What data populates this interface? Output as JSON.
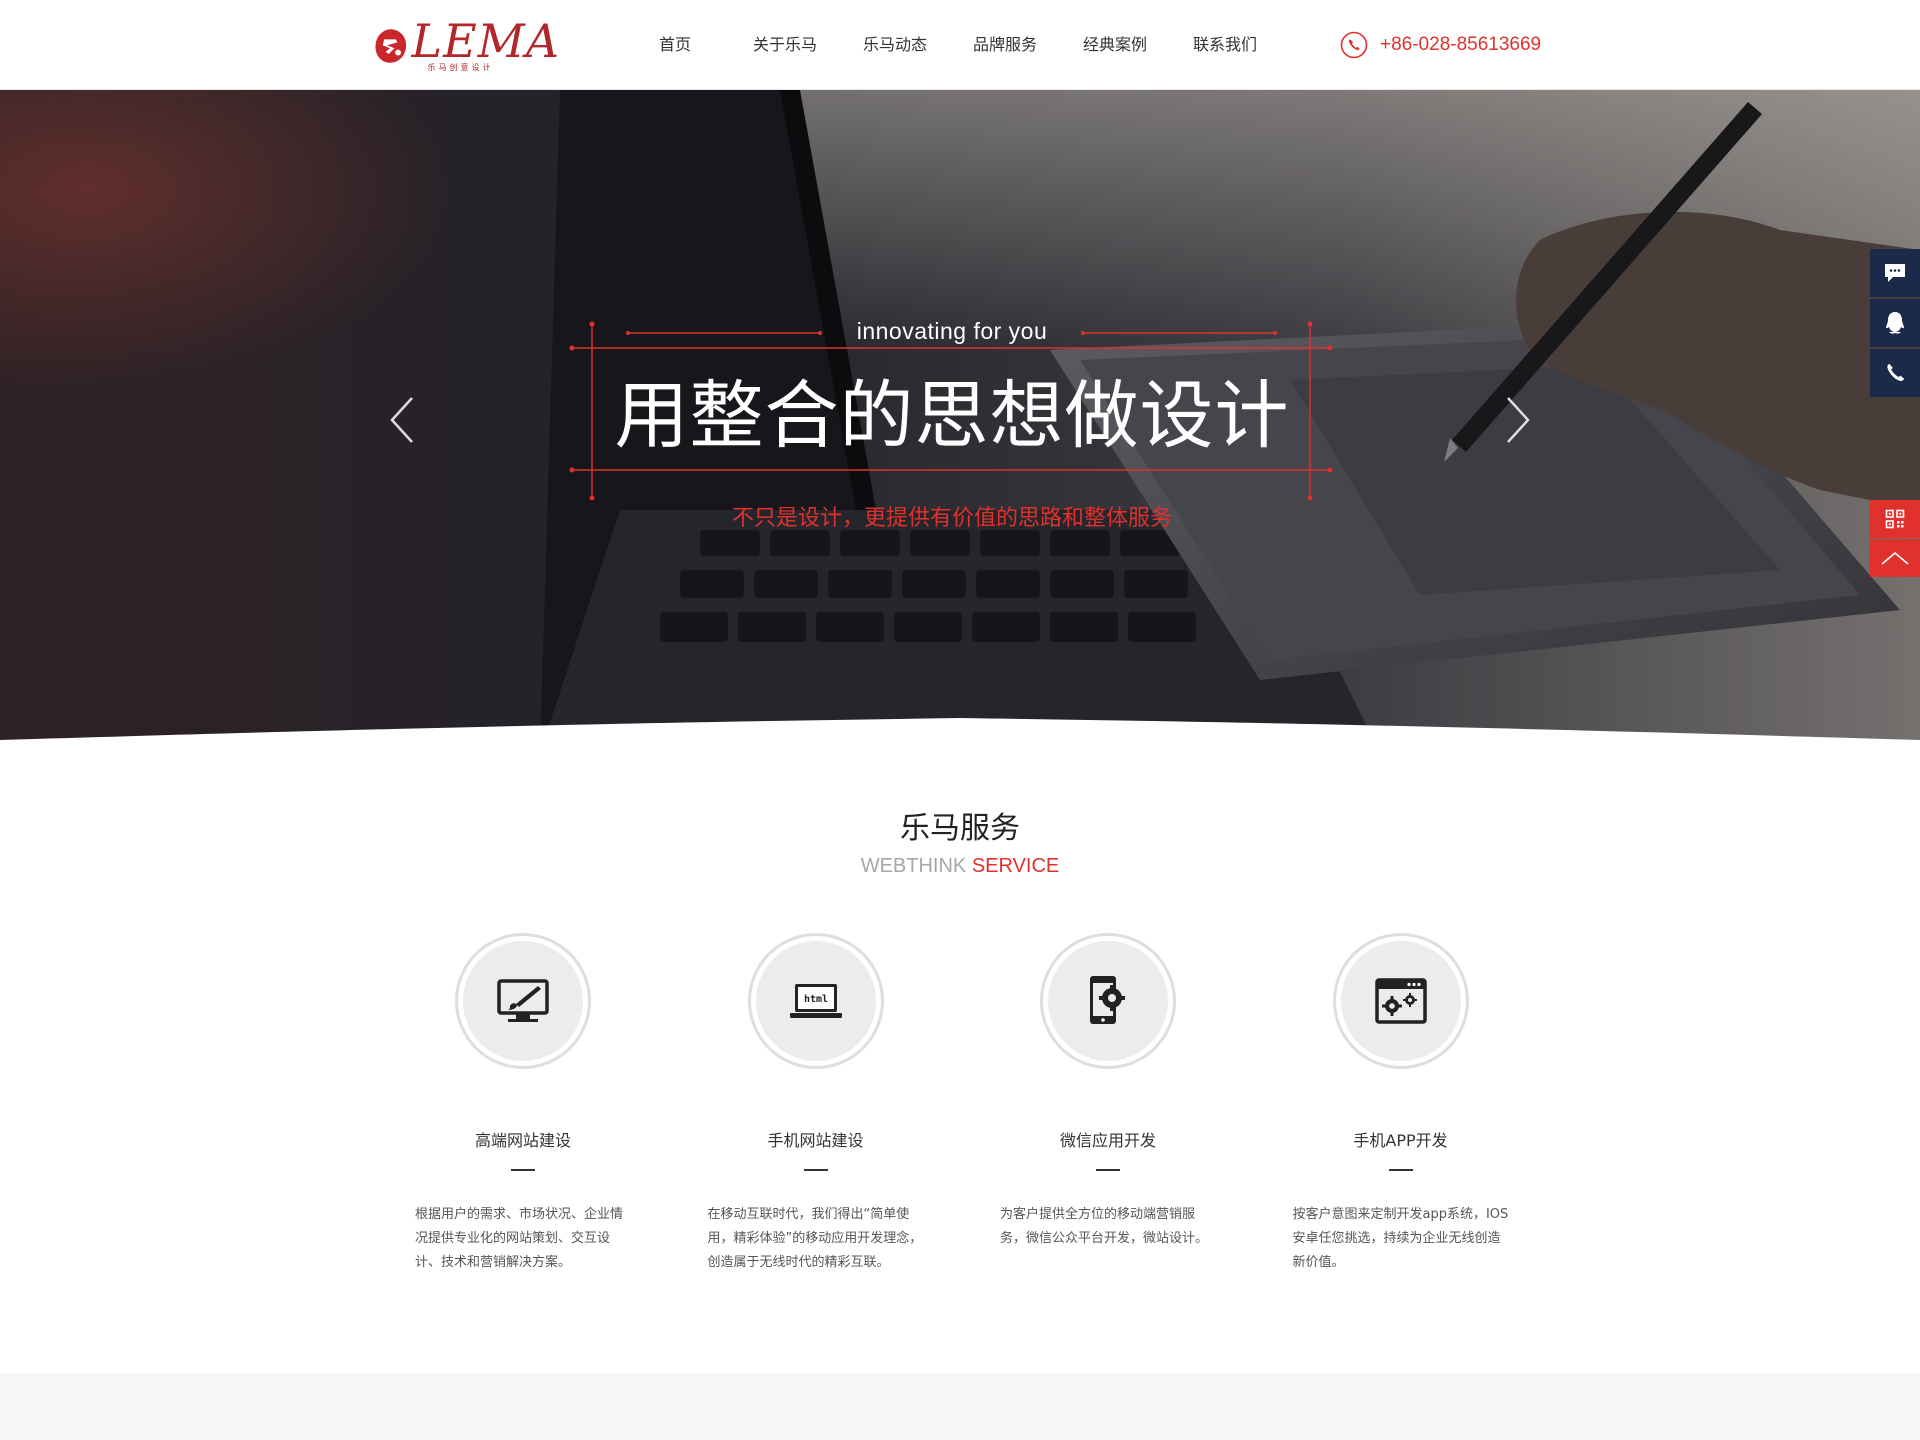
{
  "header": {
    "logo_word": "LEMA",
    "logo_sub": "乐马创意设计",
    "nav": [
      "首页",
      "关于乐马",
      "乐马动态",
      "品牌服务",
      "经典案例",
      "联系我们"
    ],
    "phone": "+86-028-85613669"
  },
  "banner": {
    "tagline_en": "innovating for you",
    "headline": "用整合的思想做设计",
    "tagline_zh": "不只是设计，更提供有价值的思路和整体服务"
  },
  "services": {
    "title": "乐马服务",
    "subtitle_gray": "WEBTHINK",
    "subtitle_red": "SERVICE",
    "items": [
      {
        "title": "高端网站建设",
        "desc": "根据用户的需求、市场状况、企业情况提供专业化的网站策划、交互设计、技术和营销解决方案。",
        "icon": "monitor-brush-icon"
      },
      {
        "title": "手机网站建设",
        "desc": "在移动互联时代，我们得出“简单使用，精彩体验”的移动应用开发理念，创造属于无线时代的精彩互联。",
        "icon": "html-laptop-icon",
        "icon_text": "html"
      },
      {
        "title": "微信应用开发",
        "desc": "为客户提供全方位的移动端营销服务，微信公众平台开发，微站设计。",
        "icon": "phone-gear-icon"
      },
      {
        "title": "手机APP开发",
        "desc": "按客户意图来定制开发app系统，IOS 安卓任您挑选，持续为企业无线创造新价值。",
        "icon": "window-gears-icon"
      }
    ]
  },
  "float_bar": [
    "message-icon",
    "qq-icon",
    "phone-icon",
    "qrcode-icon",
    "back-to-top-icon"
  ],
  "colors": {
    "accent": "#e0312d",
    "float_dark": "#1b2a4a",
    "logo": "#b3262a"
  }
}
